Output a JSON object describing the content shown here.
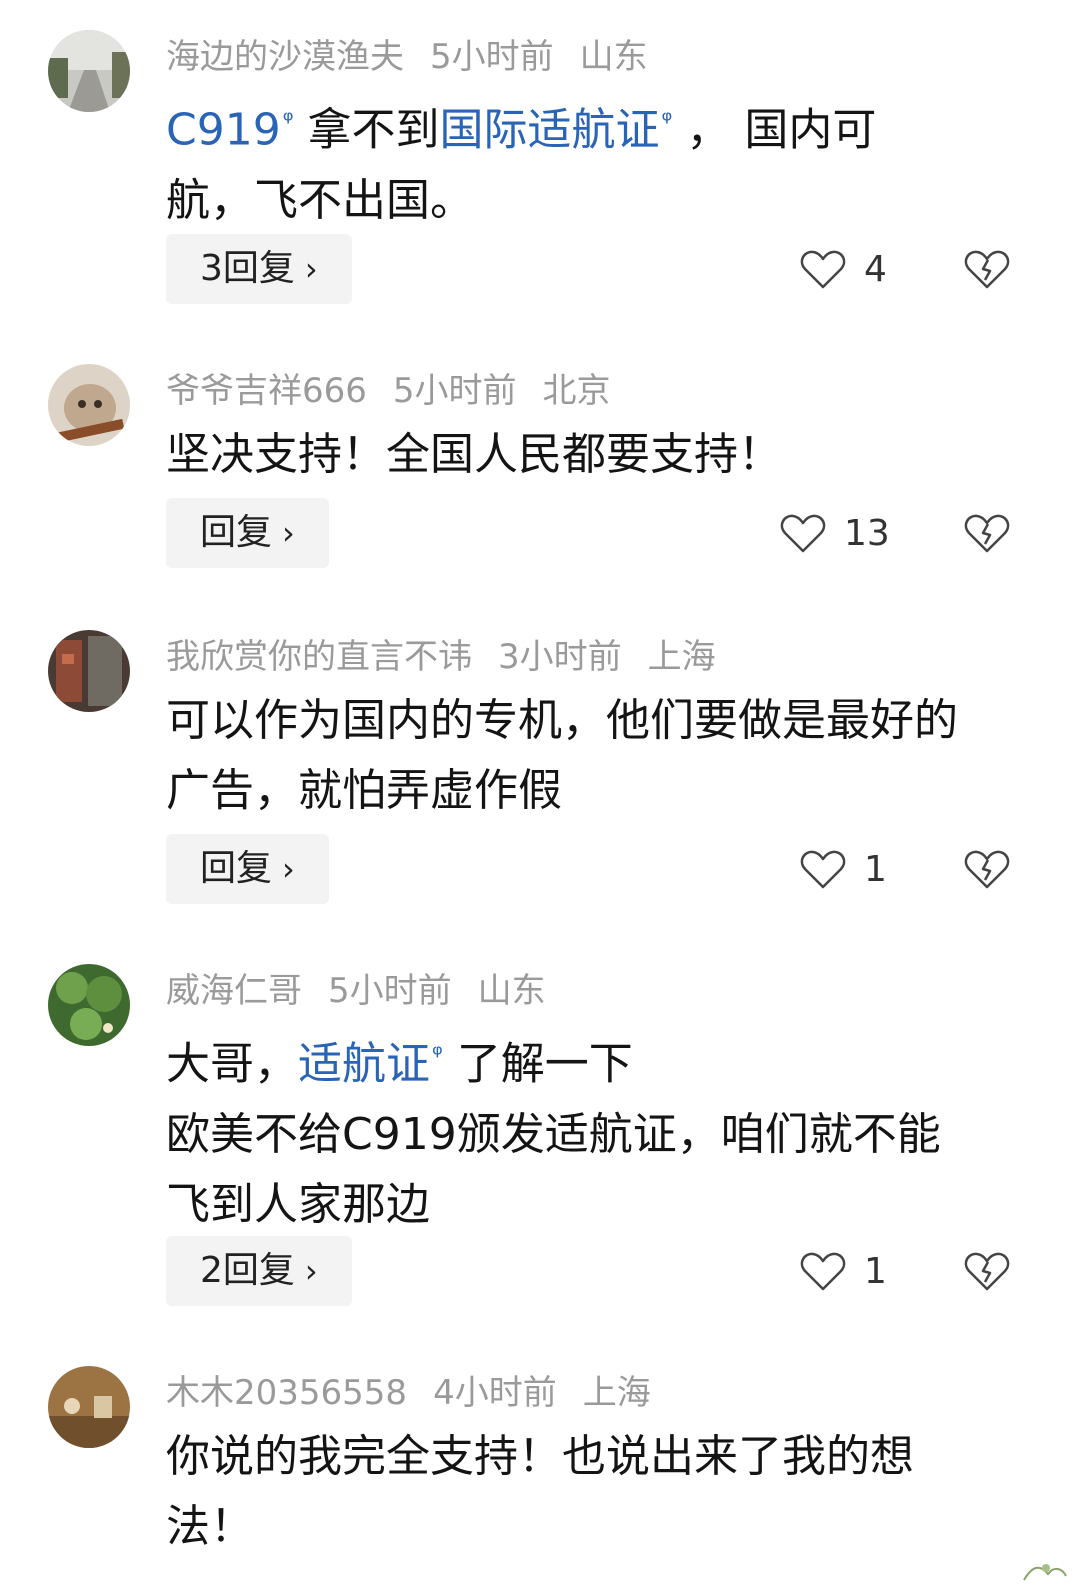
{
  "comments": [
    {
      "user": "海边的沙漠渔夫",
      "time": "5小时前",
      "location": "山东",
      "text_l1_a": "C919",
      "text_l1_b": "拿不到",
      "text_l1_c": "国际适航证",
      "text_l1_d": "，  国内可",
      "text_l2": "航，飞不出国。",
      "reply": "3回复",
      "likes": "4",
      "avatar_color": "#8f9b86"
    },
    {
      "user": "爷爷吉祥666",
      "time": "5小时前",
      "location": "北京",
      "text_l1": "坚决支持！全国人民都要支持！",
      "reply": "回复",
      "likes": "13",
      "avatar_color": "#c9b9a4"
    },
    {
      "user": "我欣赏你的直言不讳",
      "time": "3小时前",
      "location": "上海",
      "text_l1": "可以作为国内的专机，他们要做是最好的",
      "text_l2": "广告，就怕弄虚作假",
      "reply": "回复",
      "likes": "1",
      "avatar_color": "#7b5a4a"
    },
    {
      "user": "威海仁哥",
      "time": "5小时前",
      "location": "山东",
      "text_l1_a": "大哥，",
      "text_l1_b": "适航证",
      "text_l1_c": "了解一下",
      "text_l2": "欧美不给C919颁发适航证，咱们就不能",
      "text_l3": "飞到人家那边",
      "reply": "2回复",
      "likes": "1",
      "avatar_color": "#4f7a3a"
    },
    {
      "user": "木木20356558",
      "time": "4小时前",
      "location": "上海",
      "text_l1": "你说的我完全支持！也说出来了我的想",
      "text_l2": "法！",
      "avatar_color": "#a07a4a"
    }
  ],
  "icons": {
    "chevron": "›",
    "search_mark": "ᵠ"
  },
  "colors": {
    "link": "#2a64b6",
    "meta": "#9a9a9a",
    "button_bg": "#f3f3f3"
  }
}
